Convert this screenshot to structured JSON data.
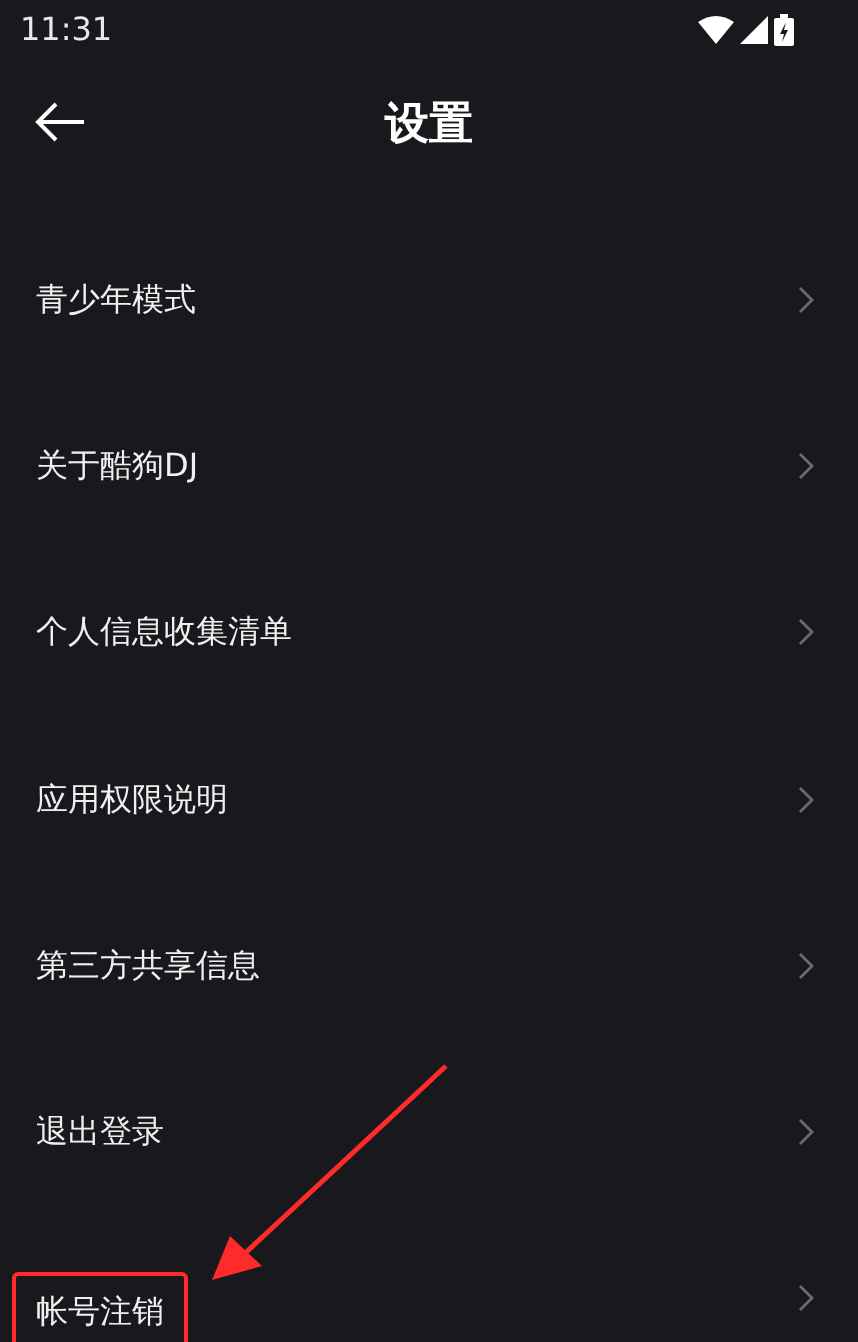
{
  "status_bar": {
    "time": "11:31"
  },
  "header": {
    "title": "设置"
  },
  "items": [
    {
      "label": "青少年模式",
      "highlighted": false
    },
    {
      "label": "关于酷狗DJ",
      "highlighted": false
    },
    {
      "label": "个人信息收集清单",
      "highlighted": false
    },
    {
      "label": "应用权限说明",
      "highlighted": false
    },
    {
      "label": "第三方共享信息",
      "highlighted": false
    },
    {
      "label": "退出登录",
      "highlighted": false
    },
    {
      "label": "帐号注销",
      "highlighted": true
    }
  ]
}
